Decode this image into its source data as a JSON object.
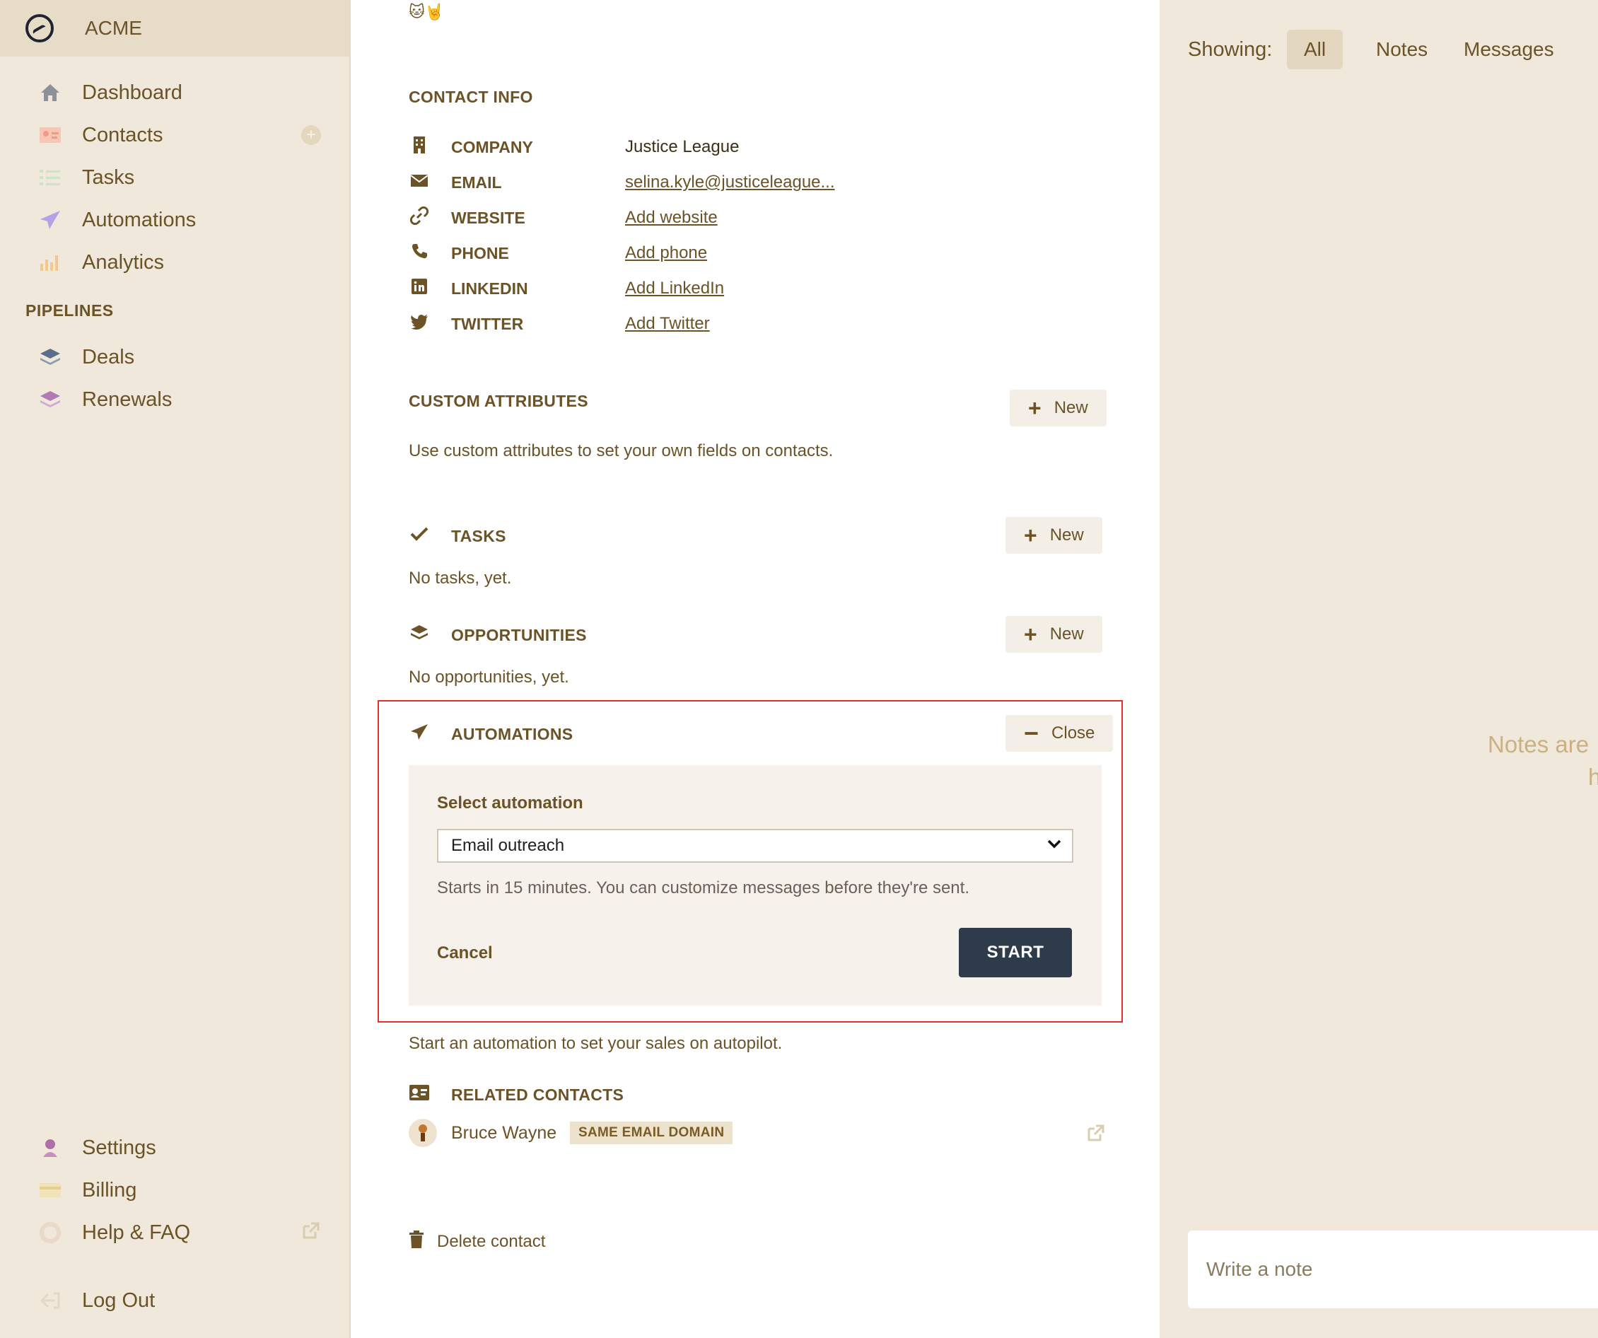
{
  "brand": {
    "name": "ACME"
  },
  "sidebar": {
    "items": [
      {
        "label": "Dashboard",
        "icon": "home-icon"
      },
      {
        "label": "Contacts",
        "icon": "contact-card-icon"
      },
      {
        "label": "Tasks",
        "icon": "checklist-icon"
      },
      {
        "label": "Automations",
        "icon": "paper-plane-icon"
      },
      {
        "label": "Analytics",
        "icon": "bar-chart-icon"
      }
    ],
    "pipelines_title": "PIPELINES",
    "pipelines": [
      {
        "label": "Deals",
        "icon": "layers-icon"
      },
      {
        "label": "Renewals",
        "icon": "layers-icon"
      }
    ],
    "bottom": [
      {
        "label": "Settings",
        "icon": "user-icon"
      },
      {
        "label": "Billing",
        "icon": "credit-card-icon"
      },
      {
        "label": "Help & FAQ",
        "icon": "lifebuoy-icon"
      },
      {
        "label": "Log Out",
        "icon": "logout-icon"
      }
    ]
  },
  "main": {
    "emoji": "🐱🤘",
    "contact_info_title": "CONTACT INFO",
    "fields": [
      {
        "label": "COMPANY",
        "value": "Justice League",
        "icon": "building-icon"
      },
      {
        "label": "EMAIL",
        "value": "selina.kyle@justiceleague...",
        "icon": "envelope-icon"
      },
      {
        "label": "WEBSITE",
        "value": "Add website",
        "icon": "link-icon"
      },
      {
        "label": "PHONE",
        "value": "Add phone",
        "icon": "phone-icon"
      },
      {
        "label": "LINKEDIN",
        "value": "Add LinkedIn",
        "icon": "linkedin-icon"
      },
      {
        "label": "TWITTER",
        "value": "Add Twitter",
        "icon": "twitter-icon"
      }
    ],
    "custom_attributes": {
      "title": "CUSTOM ATTRIBUTES",
      "button": "New",
      "description": "Use custom attributes to set your own fields on contacts."
    },
    "tasks": {
      "title": "TASKS",
      "button": "New",
      "empty": "No tasks, yet."
    },
    "opportunities": {
      "title": "OPPORTUNITIES",
      "button": "New",
      "empty": "No opportunities, yet."
    },
    "automations": {
      "title": "AUTOMATIONS",
      "close_button": "Close",
      "select_label": "Select automation",
      "selected": "Email outreach",
      "hint": "Starts in 15 minutes. You can customize messages before they're sent.",
      "cancel": "Cancel",
      "start": "START",
      "footer": "Start an automation to set your sales on autopilot."
    },
    "related": {
      "title": "RELATED CONTACTS",
      "contact_name": "Bruce Wayne",
      "badge": "SAME EMAIL DOMAIN"
    },
    "delete": "Delete contact"
  },
  "right_panel": {
    "showing_label": "Showing:",
    "filters": [
      "All",
      "Notes",
      "Messages"
    ],
    "active_filter": "All",
    "empty_text_line1": "Notes are",
    "empty_text_line2": "h",
    "note_placeholder": "Write a note"
  },
  "colors": {
    "background": "#efe8db",
    "text": "#6b5327",
    "start_button": "#2e3b4a",
    "highlight_outline": "#e0322a"
  }
}
